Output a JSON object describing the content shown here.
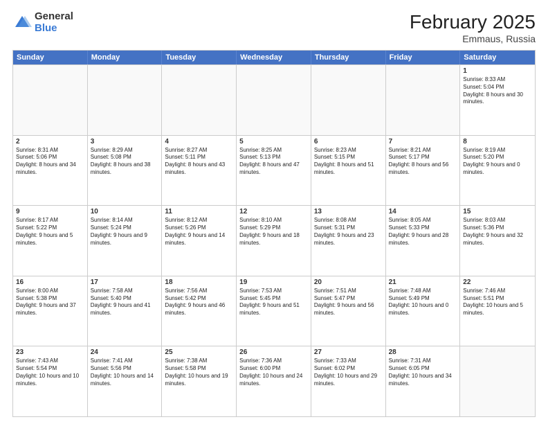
{
  "logo": {
    "general": "General",
    "blue": "Blue"
  },
  "title": {
    "month": "February 2025",
    "location": "Emmaus, Russia"
  },
  "header": {
    "days": [
      "Sunday",
      "Monday",
      "Tuesday",
      "Wednesday",
      "Thursday",
      "Friday",
      "Saturday"
    ]
  },
  "rows": [
    [
      {
        "day": "",
        "info": ""
      },
      {
        "day": "",
        "info": ""
      },
      {
        "day": "",
        "info": ""
      },
      {
        "day": "",
        "info": ""
      },
      {
        "day": "",
        "info": ""
      },
      {
        "day": "",
        "info": ""
      },
      {
        "day": "1",
        "info": "Sunrise: 8:33 AM\nSunset: 5:04 PM\nDaylight: 8 hours and 30 minutes."
      }
    ],
    [
      {
        "day": "2",
        "info": "Sunrise: 8:31 AM\nSunset: 5:06 PM\nDaylight: 8 hours and 34 minutes."
      },
      {
        "day": "3",
        "info": "Sunrise: 8:29 AM\nSunset: 5:08 PM\nDaylight: 8 hours and 38 minutes."
      },
      {
        "day": "4",
        "info": "Sunrise: 8:27 AM\nSunset: 5:11 PM\nDaylight: 8 hours and 43 minutes."
      },
      {
        "day": "5",
        "info": "Sunrise: 8:25 AM\nSunset: 5:13 PM\nDaylight: 8 hours and 47 minutes."
      },
      {
        "day": "6",
        "info": "Sunrise: 8:23 AM\nSunset: 5:15 PM\nDaylight: 8 hours and 51 minutes."
      },
      {
        "day": "7",
        "info": "Sunrise: 8:21 AM\nSunset: 5:17 PM\nDaylight: 8 hours and 56 minutes."
      },
      {
        "day": "8",
        "info": "Sunrise: 8:19 AM\nSunset: 5:20 PM\nDaylight: 9 hours and 0 minutes."
      }
    ],
    [
      {
        "day": "9",
        "info": "Sunrise: 8:17 AM\nSunset: 5:22 PM\nDaylight: 9 hours and 5 minutes."
      },
      {
        "day": "10",
        "info": "Sunrise: 8:14 AM\nSunset: 5:24 PM\nDaylight: 9 hours and 9 minutes."
      },
      {
        "day": "11",
        "info": "Sunrise: 8:12 AM\nSunset: 5:26 PM\nDaylight: 9 hours and 14 minutes."
      },
      {
        "day": "12",
        "info": "Sunrise: 8:10 AM\nSunset: 5:29 PM\nDaylight: 9 hours and 18 minutes."
      },
      {
        "day": "13",
        "info": "Sunrise: 8:08 AM\nSunset: 5:31 PM\nDaylight: 9 hours and 23 minutes."
      },
      {
        "day": "14",
        "info": "Sunrise: 8:05 AM\nSunset: 5:33 PM\nDaylight: 9 hours and 28 minutes."
      },
      {
        "day": "15",
        "info": "Sunrise: 8:03 AM\nSunset: 5:36 PM\nDaylight: 9 hours and 32 minutes."
      }
    ],
    [
      {
        "day": "16",
        "info": "Sunrise: 8:00 AM\nSunset: 5:38 PM\nDaylight: 9 hours and 37 minutes."
      },
      {
        "day": "17",
        "info": "Sunrise: 7:58 AM\nSunset: 5:40 PM\nDaylight: 9 hours and 41 minutes."
      },
      {
        "day": "18",
        "info": "Sunrise: 7:56 AM\nSunset: 5:42 PM\nDaylight: 9 hours and 46 minutes."
      },
      {
        "day": "19",
        "info": "Sunrise: 7:53 AM\nSunset: 5:45 PM\nDaylight: 9 hours and 51 minutes."
      },
      {
        "day": "20",
        "info": "Sunrise: 7:51 AM\nSunset: 5:47 PM\nDaylight: 9 hours and 56 minutes."
      },
      {
        "day": "21",
        "info": "Sunrise: 7:48 AM\nSunset: 5:49 PM\nDaylight: 10 hours and 0 minutes."
      },
      {
        "day": "22",
        "info": "Sunrise: 7:46 AM\nSunset: 5:51 PM\nDaylight: 10 hours and 5 minutes."
      }
    ],
    [
      {
        "day": "23",
        "info": "Sunrise: 7:43 AM\nSunset: 5:54 PM\nDaylight: 10 hours and 10 minutes."
      },
      {
        "day": "24",
        "info": "Sunrise: 7:41 AM\nSunset: 5:56 PM\nDaylight: 10 hours and 14 minutes."
      },
      {
        "day": "25",
        "info": "Sunrise: 7:38 AM\nSunset: 5:58 PM\nDaylight: 10 hours and 19 minutes."
      },
      {
        "day": "26",
        "info": "Sunrise: 7:36 AM\nSunset: 6:00 PM\nDaylight: 10 hours and 24 minutes."
      },
      {
        "day": "27",
        "info": "Sunrise: 7:33 AM\nSunset: 6:02 PM\nDaylight: 10 hours and 29 minutes."
      },
      {
        "day": "28",
        "info": "Sunrise: 7:31 AM\nSunset: 6:05 PM\nDaylight: 10 hours and 34 minutes."
      },
      {
        "day": "",
        "info": ""
      }
    ]
  ]
}
